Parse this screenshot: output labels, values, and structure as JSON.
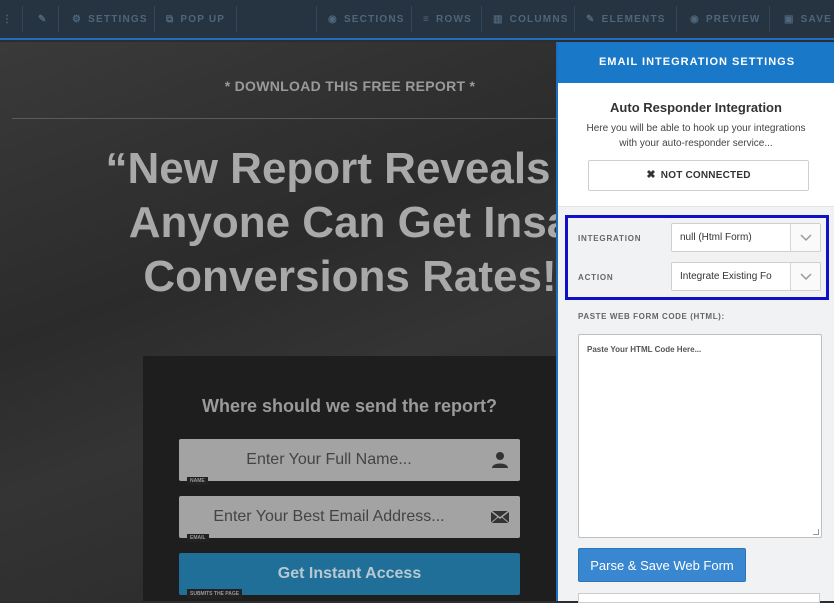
{
  "toolbar": {
    "items": [
      {
        "label": "SETTINGS",
        "icon": "gear-icon"
      },
      {
        "label": "POP UP",
        "icon": "popup-icon"
      },
      {
        "label": "SECTIONS",
        "icon": "sections-icon"
      },
      {
        "label": "ROWS",
        "icon": "rows-icon"
      },
      {
        "label": "COLUMNS",
        "icon": "columns-icon"
      },
      {
        "label": "ELEMENTS",
        "icon": "pencil-icon"
      },
      {
        "label": "PREVIEW",
        "icon": "eye-icon"
      },
      {
        "label": "SAVE",
        "icon": "save-icon"
      }
    ]
  },
  "canvas": {
    "download_label": "* DOWNLOAD THIS FREE REPORT *",
    "headline_line1": "“New Report Reveals H",
    "headline_line2": "Anyone Can Get Insa",
    "headline_line3": "Conversions Rates!",
    "optin": {
      "question": "Where should we send the report?",
      "name_placeholder": "Enter Your Full Name...",
      "name_tag": "NAME",
      "email_placeholder": "Enter Your Best Email Address...",
      "email_tag": "EMAIL",
      "button_label": "Get Instant Access",
      "button_tag": "SUBMITS THE PAGE"
    }
  },
  "panel": {
    "title": "EMAIL INTEGRATION SETTINGS",
    "autoresponder": {
      "heading": "Auto Responder Integration",
      "description": "Here you will be able to hook up your integrations with your auto-responder service...",
      "status": "NOT CONNECTED"
    },
    "integration_label": "INTEGRATION",
    "integration_value": "null (Html Form)",
    "action_label": "ACTION",
    "action_value": "Integrate Existing Fo",
    "paste_label": "PASTE WEB FORM CODE (HTML):",
    "textarea_placeholder": "Paste Your HTML Code Here...",
    "parse_button": "Parse & Save Web Form"
  },
  "colors": {
    "accent": "#1a78c8",
    "highlight_border": "#1010c8",
    "toolbar_bg": "#263340"
  }
}
